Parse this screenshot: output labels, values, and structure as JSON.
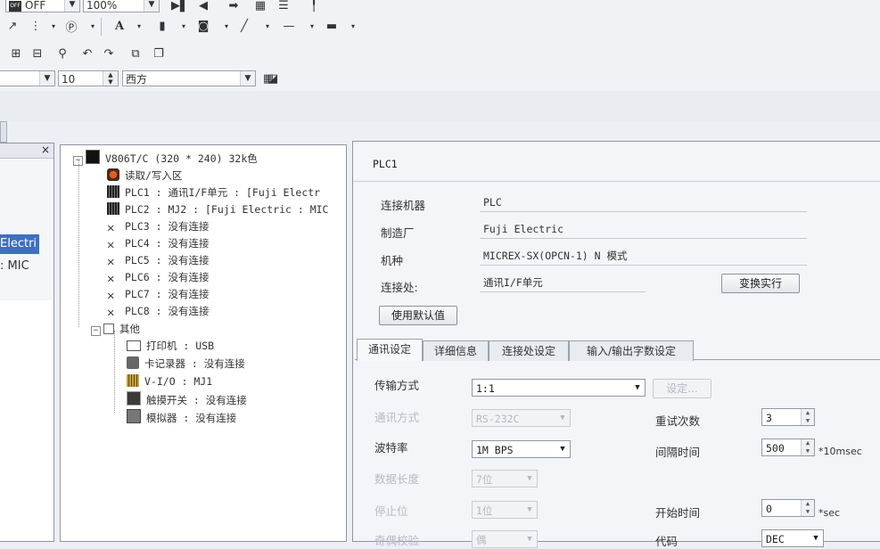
{
  "toolbar1": {
    "state_combo": "OFF",
    "zoom_combo": "100%"
  },
  "toolbar2": {
    "text_tool": "A"
  },
  "toolbar4": {
    "font_size": "10",
    "font_name": "西方"
  },
  "left_panel": {
    "close": "×",
    "line1": "Electri",
    "line2": ": MIC"
  },
  "tree": {
    "root": "V806T/C (320 * 240) 32k色",
    "items": [
      {
        "label": "读取/写入区"
      },
      {
        "label": "PLC1 : 通讯I/F单元 : [Fuji Electr"
      },
      {
        "label": "PLC2 : MJ2 : [Fuji Electric : MIC"
      },
      {
        "label": "PLC3 : 没有连接"
      },
      {
        "label": "PLC4 : 没有连接"
      },
      {
        "label": "PLC5 : 没有连接"
      },
      {
        "label": "PLC6 : 没有连接"
      },
      {
        "label": "PLC7 : 没有连接"
      },
      {
        "label": "PLC8 : 没有连接"
      }
    ],
    "other": "其他",
    "other_items": [
      {
        "label": "打印机 : USB"
      },
      {
        "label": "卡记录器 : 没有连接"
      },
      {
        "label": "V-I/O : MJ1"
      },
      {
        "label": "触摸开关 : 没有连接"
      },
      {
        "label": "模拟器 : 没有连接"
      }
    ]
  },
  "right_panel": {
    "title": "PLC1",
    "fields": [
      {
        "label": "连接机器",
        "value": "PLC"
      },
      {
        "label": "制造厂",
        "value": "Fuji Electric"
      },
      {
        "label": "机种",
        "value": "MICREX-SX(OPCN-1) N 模式"
      },
      {
        "label": "连接处:",
        "value": "通讯I/F单元"
      }
    ],
    "change_button": "变换实行",
    "default_button": "使用默认值",
    "tabs": [
      "通讯设定",
      "详细信息",
      "连接处设定",
      "输入/输出字数设定"
    ],
    "comm": {
      "transfer_label": "传输方式",
      "transfer_value": "1:1",
      "setting_button": "设定...",
      "comm_label": "通讯方式",
      "comm_value": "RS-232C",
      "baud_label": "波特率",
      "baud_value": "1M BPS",
      "datalen_label": "数据长度",
      "datalen_value": "7位",
      "stop_label": "停止位",
      "stop_value": "1位",
      "parity_label": "奇偶校验",
      "parity_value": "偶",
      "retry_label": "重试次数",
      "retry_value": "3",
      "interval_label": "间隔时间",
      "interval_value": "500",
      "interval_unit": "*10msec",
      "start_label": "开始时间",
      "start_value": "0",
      "start_unit": "*sec",
      "code_label": "代码",
      "code_value": "DEC"
    }
  }
}
